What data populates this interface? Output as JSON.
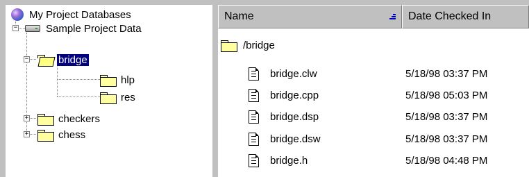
{
  "tree": {
    "root_label": "My Project Databases",
    "database_label": "Sample Project Data",
    "selected_folder": "bridge",
    "subfolders": [
      "hlp",
      "res"
    ],
    "sibling_folders": [
      "checkers",
      "chess"
    ],
    "expanded_symbol": "−",
    "collapsed_symbol": "+"
  },
  "list": {
    "columns": {
      "name": "Name",
      "date": "Date Checked In"
    },
    "current_path": "/bridge",
    "files": [
      {
        "name": "bridge.clw",
        "date": "5/18/98 03:37 PM"
      },
      {
        "name": "bridge.cpp",
        "date": "5/18/98 05:03 PM"
      },
      {
        "name": "bridge.dsp",
        "date": "5/18/98 03:37 PM"
      },
      {
        "name": "bridge.dsw",
        "date": "5/18/98 03:37 PM"
      },
      {
        "name": "bridge.h",
        "date": "5/18/98 04:48 PM"
      }
    ]
  },
  "colors": {
    "selection_bg": "#000080",
    "selection_fg": "#ffffff",
    "sort_indicator": "#0000c0"
  }
}
